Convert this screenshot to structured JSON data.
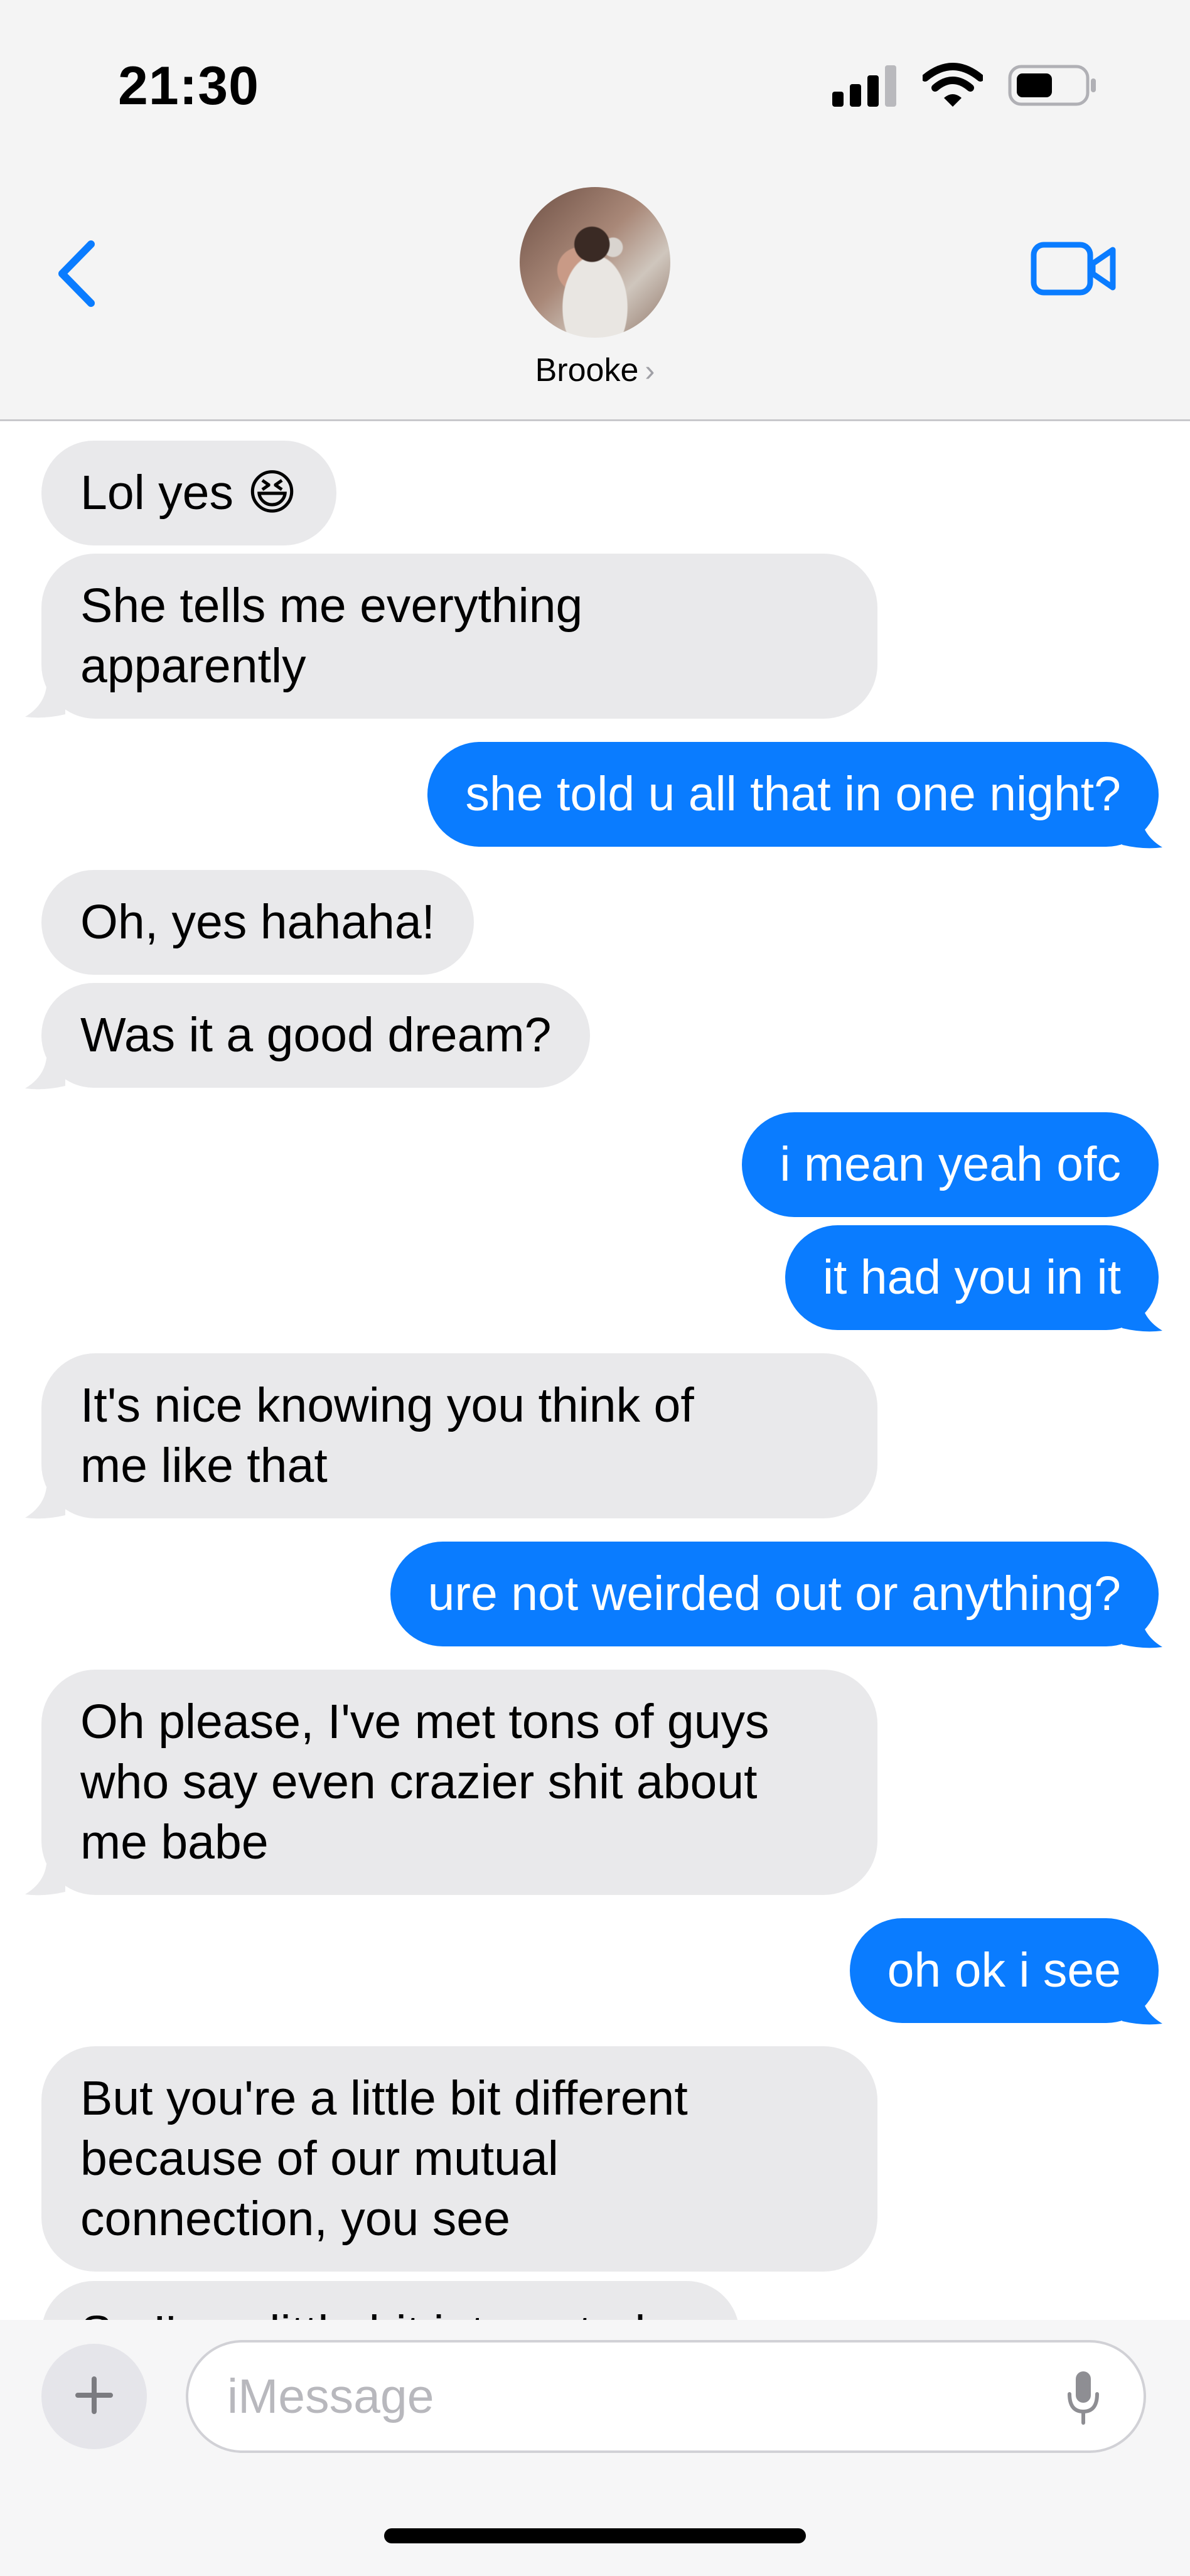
{
  "status_bar": {
    "time": "21:30",
    "icons": [
      "cellular-signal-icon",
      "wifi-icon",
      "battery-icon"
    ]
  },
  "header": {
    "back_icon": "chevron-left-icon",
    "contact_name": "Brooke",
    "contact_chevron": "›",
    "video_icon": "video-camera-icon",
    "accent_color": "#0a7cff"
  },
  "messages": [
    {
      "direction": "in",
      "text": "Lol yes 😆"
    },
    {
      "direction": "in",
      "text": "She tells me everything\napparently"
    },
    {
      "direction": "out",
      "text": "she told u all that in one night?"
    },
    {
      "direction": "in",
      "text": "Oh, yes hahaha!"
    },
    {
      "direction": "in",
      "text": "Was it a good dream?"
    },
    {
      "direction": "out",
      "text": "i mean yeah ofc"
    },
    {
      "direction": "out",
      "text": "it had you in it"
    },
    {
      "direction": "in",
      "text": "It's nice knowing you think of\nme like that"
    },
    {
      "direction": "out",
      "text": "ure not weirded out or anything?"
    },
    {
      "direction": "in",
      "text": "Oh please, I've met tons of guys\nwho say even crazier shit about\nme babe"
    },
    {
      "direction": "out",
      "text": "oh ok i see"
    },
    {
      "direction": "in",
      "text": "But you're a little bit different\nbecause of our mutual\nconnection, you see"
    },
    {
      "direction": "in",
      "text": "So I'm a little bit interested"
    }
  ],
  "colors": {
    "incoming_bubble": "#e9e9eb",
    "outgoing_bubble": "#0a7cff"
  },
  "composer": {
    "plus_icon": "plus-icon",
    "placeholder": "iMessage",
    "mic_icon": "microphone-icon"
  }
}
